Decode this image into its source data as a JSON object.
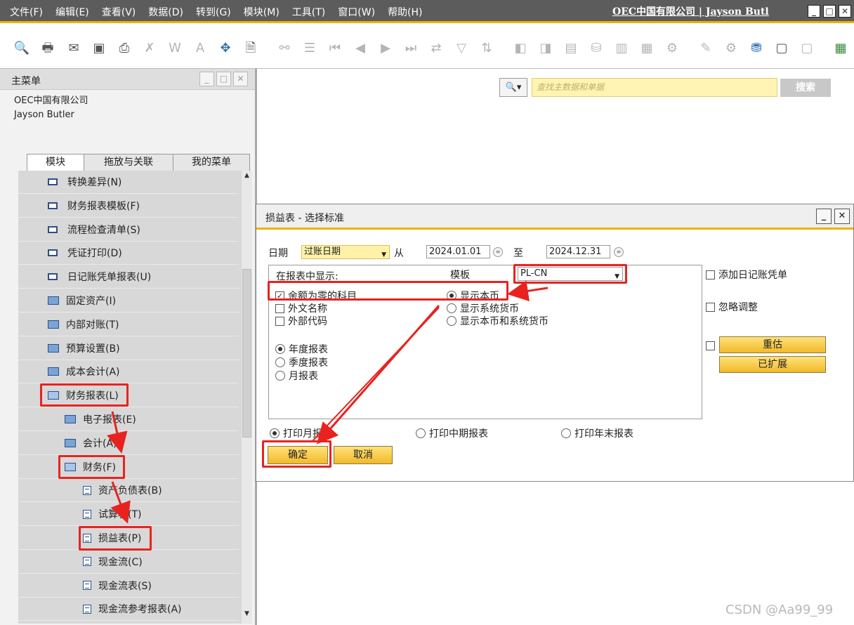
{
  "menubar": {
    "items": [
      "文件(F)",
      "编辑(E)",
      "查看(V)",
      "数据(D)",
      "转到(G)",
      "模块(M)",
      "工具(T)",
      "窗口(W)",
      "帮助(H)"
    ],
    "company_user": "OEC中国有限公司 | Jayson Butl"
  },
  "toolbar": {
    "icons": [
      "preview-icon",
      "print-icon",
      "email-icon",
      "sms-icon",
      "fax-icon",
      "export-excel-icon",
      "export-word-icon",
      "export-pdf-icon",
      "launch-app-icon",
      "lock-screen-icon",
      "find-icon",
      "add-icon",
      "first-record-icon",
      "previous-record-icon",
      "next-record-icon",
      "last-record-icon",
      "refresh-icon",
      "filter-icon",
      "sort-icon",
      "base-document-icon",
      "target-document-icon",
      "journal-icon",
      "payment-icon",
      "gross-profit-icon",
      "volume-icon",
      "settings-icon",
      "edit-icon",
      "form-settings-icon",
      "data-icon",
      "message-icon",
      "alerts-icon",
      "calendar-icon"
    ]
  },
  "main_menu": {
    "title": "主菜单",
    "company": "OEC中国有限公司",
    "user": "Jayson Butler",
    "tabs": [
      "模块",
      "拖放与关联",
      "我的菜单"
    ],
    "items": [
      {
        "label": "转换差异(N)",
        "type": "window",
        "level": 0
      },
      {
        "label": "财务报表模板(F)",
        "type": "window",
        "level": 0
      },
      {
        "label": "流程检查清单(S)",
        "type": "window",
        "level": 0
      },
      {
        "label": "凭证打印(D)",
        "type": "window",
        "level": 0
      },
      {
        "label": "日记账凭单报表(U)",
        "type": "window",
        "level": 0
      },
      {
        "label": "固定资产(I)",
        "type": "folder",
        "level": 0
      },
      {
        "label": "内部对账(T)",
        "type": "folder",
        "level": 0
      },
      {
        "label": "预算设置(B)",
        "type": "folder",
        "level": 0
      },
      {
        "label": "成本会计(A)",
        "type": "folder",
        "level": 0
      },
      {
        "label": "财务报表(L)",
        "type": "folder-open",
        "level": 0
      },
      {
        "label": "电子报表(E)",
        "type": "folder",
        "level": 1
      },
      {
        "label": "会计(A)",
        "type": "folder",
        "level": 1
      },
      {
        "label": "财务(F)",
        "type": "folder-open",
        "level": 1
      },
      {
        "label": "资产负债表(B)",
        "type": "report",
        "level": 2
      },
      {
        "label": "试算表(T)",
        "type": "report",
        "level": 2
      },
      {
        "label": "损益表(P)",
        "type": "report",
        "level": 2
      },
      {
        "label": "现金流(C)",
        "type": "report",
        "level": 2
      },
      {
        "label": "现金流表(S)",
        "type": "report",
        "level": 2
      },
      {
        "label": "现金流参考报表(A)",
        "type": "report",
        "level": 2
      }
    ]
  },
  "search": {
    "placeholder": "查找主数据和单据",
    "button": "搜索"
  },
  "dialog": {
    "title": "损益表 - 选择标准",
    "date_label": "日期",
    "date_type": "过账日期",
    "from_label": "从",
    "from_value": "2024.01.01",
    "to_label": "至",
    "to_value": "2024.12.31",
    "display_label": "在报表中显示:",
    "template_label": "模板",
    "template_value": "PL-CN",
    "checkboxes": [
      {
        "label": "余额为零的科目",
        "checked": true
      },
      {
        "label": "外文名称",
        "checked": false
      },
      {
        "label": "外部代码",
        "checked": false
      }
    ],
    "currency_options": [
      {
        "label": "显示本币",
        "selected": true
      },
      {
        "label": "显示系统货币",
        "selected": false
      },
      {
        "label": "显示本币和系统货币",
        "selected": false
      }
    ],
    "period_options": [
      {
        "label": "年度报表",
        "selected": true
      },
      {
        "label": "季度报表",
        "selected": false
      },
      {
        "label": "月报表",
        "selected": false
      }
    ],
    "right_options": {
      "add_journal": "添加日记账凭单",
      "ignore_adjust": "忽略调整",
      "revalue_button": "重估",
      "expanded_button": "已扩展"
    },
    "print_options": [
      {
        "label": "打印月报表",
        "selected": true
      },
      {
        "label": "打印中期报表",
        "selected": false
      },
      {
        "label": "打印年末报表",
        "selected": false
      }
    ],
    "ok_button": "确定",
    "cancel_button": "取消"
  },
  "watermark": "CSDN @Aa99_99",
  "colors": {
    "accent": "#f0b000",
    "annotation_red": "#e8231f",
    "menubar_bg": "#5c5c5c"
  }
}
